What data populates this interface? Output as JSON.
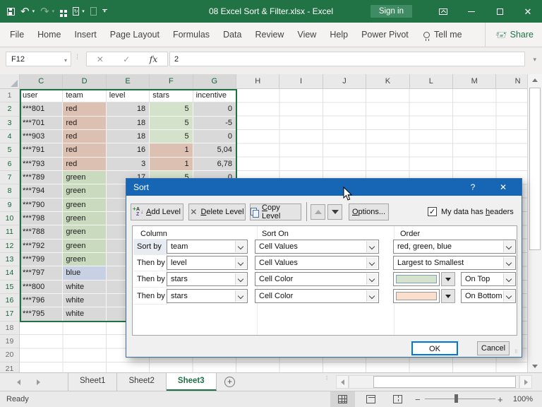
{
  "titlebar": {
    "title": "08 Excel Sort & Filter.xlsx  -  Excel",
    "sign_in": "Sign in"
  },
  "ribbon": {
    "tabs": [
      "File",
      "Home",
      "Insert",
      "Page Layout",
      "Formulas",
      "Data",
      "Review",
      "View",
      "Help",
      "Power Pivot"
    ],
    "tell_me": "Tell me",
    "share": "Share"
  },
  "formula_bar": {
    "name_box": "F12",
    "cancel_glyph": "✕",
    "enter_glyph": "✓",
    "fx": "fx",
    "value": "2"
  },
  "grid": {
    "column_letters": [
      "C",
      "D",
      "E",
      "F",
      "G",
      "H",
      "I",
      "J",
      "K",
      "L",
      "M",
      "N"
    ],
    "selected_columns": [
      "C",
      "D",
      "E",
      "F",
      "G"
    ],
    "visible_row_numbers": 21,
    "selected_rows_from": 2,
    "selected_rows_to": 17,
    "header_row": [
      "user",
      "team",
      "level",
      "stars",
      "incentive"
    ],
    "fills": {
      "selection": "#d9d9d9",
      "red": "#dcc0b1",
      "green": "#cadabf",
      "blue": "#c8d1e3",
      "white": "#d9d9d9",
      "stars_green": "#d5e2cb",
      "stars_red": "#dcc0b1"
    },
    "rows": [
      {
        "n": 2,
        "user": "***801",
        "team": "red",
        "level": "18",
        "stars": "5",
        "incentive": "0",
        "stars_fill": "stars_green"
      },
      {
        "n": 3,
        "user": "***701",
        "team": "red",
        "level": "18",
        "stars": "5",
        "incentive": "-5",
        "stars_fill": "stars_green"
      },
      {
        "n": 4,
        "user": "***903",
        "team": "red",
        "level": "18",
        "stars": "5",
        "incentive": "0",
        "stars_fill": "stars_green"
      },
      {
        "n": 5,
        "user": "***791",
        "team": "red",
        "level": "16",
        "stars": "1",
        "incentive": "5,04",
        "stars_fill": "stars_red"
      },
      {
        "n": 6,
        "user": "***793",
        "team": "red",
        "level": "3",
        "stars": "1",
        "incentive": "6,78",
        "stars_fill": "stars_red"
      },
      {
        "n": 7,
        "user": "***789",
        "team": "green",
        "level": "17",
        "stars": "5",
        "incentive": "0",
        "stars_fill": "stars_green"
      },
      {
        "n": 8,
        "user": "***794",
        "team": "green",
        "level": "",
        "stars": "",
        "incentive": "",
        "stars_fill": ""
      },
      {
        "n": 9,
        "user": "***790",
        "team": "green",
        "level": "",
        "stars": "",
        "incentive": "",
        "stars_fill": ""
      },
      {
        "n": 10,
        "user": "***798",
        "team": "green",
        "level": "",
        "stars": "",
        "incentive": "",
        "stars_fill": ""
      },
      {
        "n": 11,
        "user": "***788",
        "team": "green",
        "level": "",
        "stars": "",
        "incentive": "",
        "stars_fill": ""
      },
      {
        "n": 12,
        "user": "***792",
        "team": "green",
        "level": "",
        "stars": "",
        "incentive": "",
        "stars_fill": ""
      },
      {
        "n": 13,
        "user": "***799",
        "team": "green",
        "level": "",
        "stars": "",
        "incentive": "",
        "stars_fill": ""
      },
      {
        "n": 14,
        "user": "***797",
        "team": "blue",
        "level": "",
        "stars": "",
        "incentive": "",
        "stars_fill": ""
      },
      {
        "n": 15,
        "user": "***800",
        "team": "white",
        "level": "",
        "stars": "",
        "incentive": "",
        "stars_fill": ""
      },
      {
        "n": 16,
        "user": "***796",
        "team": "white",
        "level": "",
        "stars": "",
        "incentive": "",
        "stars_fill": ""
      },
      {
        "n": 17,
        "user": "***795",
        "team": "white",
        "level": "",
        "stars": "",
        "incentive": "",
        "stars_fill": ""
      }
    ]
  },
  "sort_dialog": {
    "title": "Sort",
    "help": "?",
    "close": "✕",
    "add_level": {
      "pre": "",
      "mn": "A",
      "post": "dd Level"
    },
    "delete_level": {
      "pre": "",
      "mn": "D",
      "post": "elete Level"
    },
    "copy_level": {
      "pre": "",
      "mn": "C",
      "post": "opy Level"
    },
    "options": {
      "pre": "",
      "mn": "O",
      "post": "ptions..."
    },
    "header_checkbox": {
      "pre": "My data has ",
      "mn": "h",
      "post": "eaders",
      "checked": true
    },
    "grid_headers": {
      "column": "Column",
      "sort_on": "Sort On",
      "order": "Order"
    },
    "rows": [
      {
        "label": "Sort by",
        "column": "team",
        "sort_on": "Cell Values",
        "order": "red, green, blue"
      },
      {
        "label": "Then by",
        "column": "level",
        "sort_on": "Cell Values",
        "order": "Largest to Smallest"
      },
      {
        "label": "Then by",
        "column": "stars",
        "sort_on": "Cell Color",
        "swatch": "#d6e3cc",
        "order": "On Top"
      },
      {
        "label": "Then by",
        "column": "stars",
        "sort_on": "Cell Color",
        "swatch": "#fbdfcc",
        "order": "On Bottom"
      }
    ],
    "ok": "OK",
    "cancel": "Cancel"
  },
  "sheet_tabs": {
    "items": [
      {
        "label": "Sheet1",
        "active": false
      },
      {
        "label": "Sheet2",
        "active": false
      },
      {
        "label": "Sheet3",
        "active": true
      }
    ]
  },
  "status_bar": {
    "ready": "Ready",
    "zoom": "100%"
  }
}
